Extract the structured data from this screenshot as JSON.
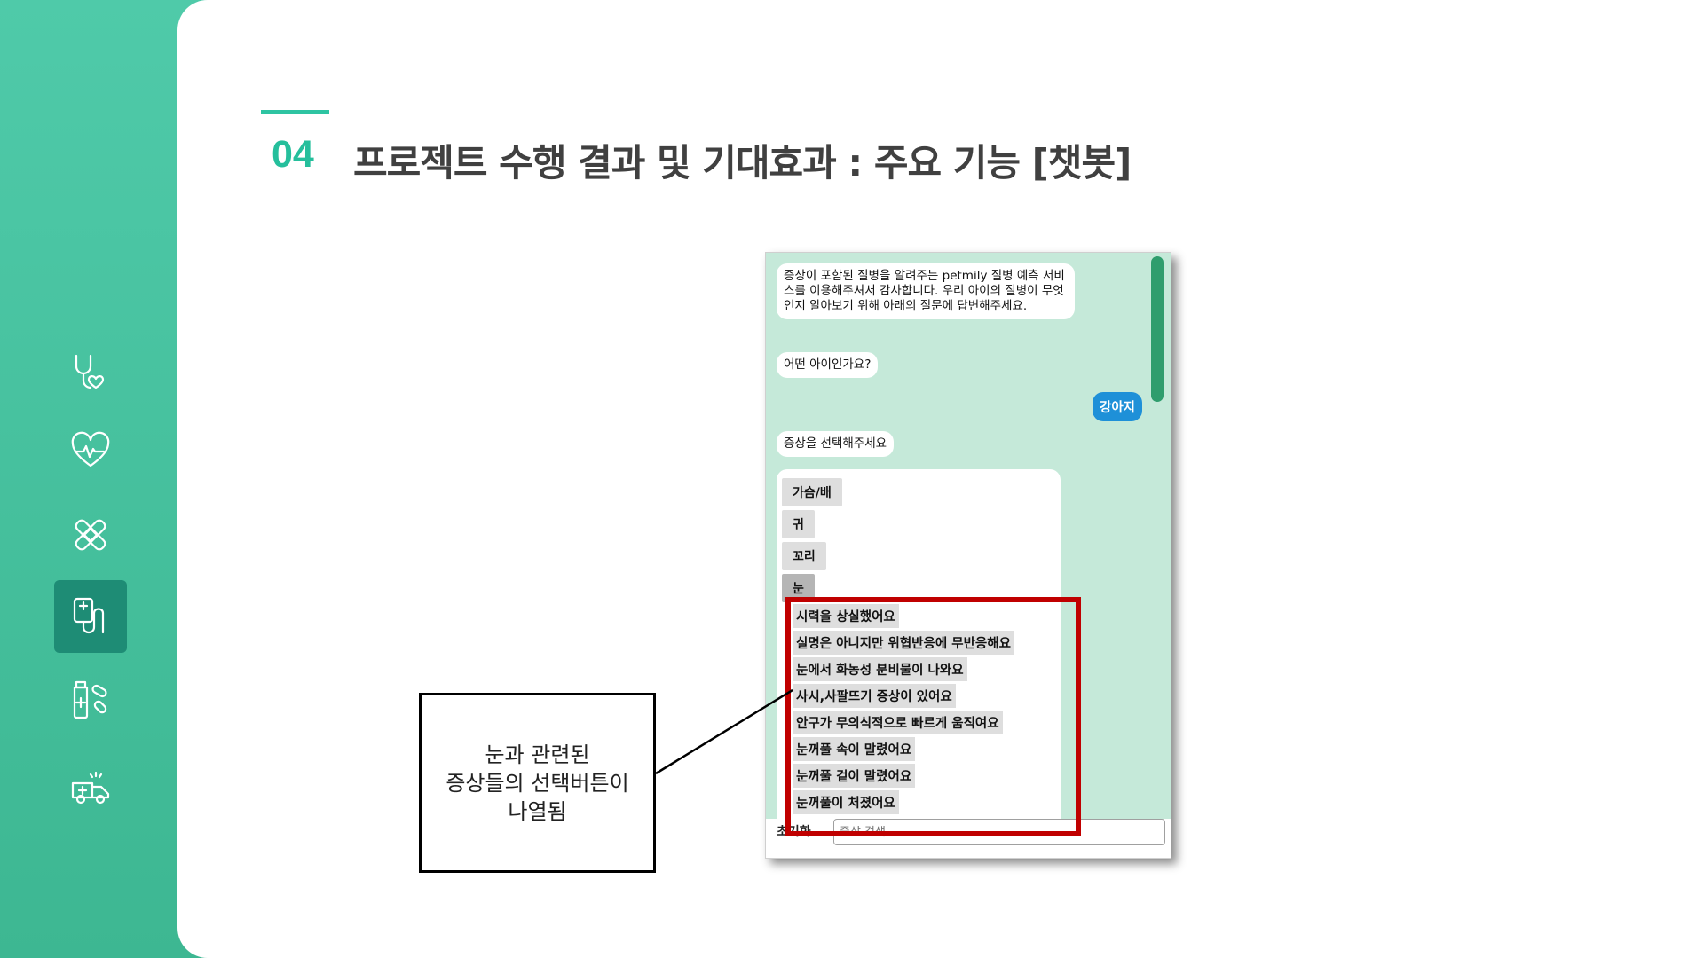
{
  "header": {
    "number": "04",
    "title": "프로젝트 수행 결과 및 기대효과 : 주요 기능 [챗봇]"
  },
  "sidebar": {
    "icons": [
      "stethoscope-heart-icon",
      "heartbeat-icon",
      "bandage-icon",
      "iv-drip-icon",
      "medicine-pills-icon",
      "ambulance-icon"
    ],
    "active_index": 3
  },
  "chat": {
    "greeting": "증상이 포함된 질병을 알려주는 petmily 질병 예측 서비스를 이용해주셔서 감사합니다. 우리 아이의 질병이 무엇인지 알아보기 위해 아래의 질문에 답변해주세요.",
    "q_animal": "어떤 아이인가요?",
    "user_answer": "강아지",
    "q_symptom": "증상을 선택해주세요",
    "body_parts": [
      "가슴/배",
      "귀",
      "꼬리",
      "눈"
    ],
    "selected_part": "눈",
    "eye_symptoms": [
      "시력을 상실했어요",
      "실명은 아니지만 위협반응에 무반응해요",
      "눈에서 화농성 분비물이 나와요",
      "사시,사팔뜨기 증상이 있어요",
      "안구가 무의식적으로 빠르게 움직여요",
      "눈꺼풀 속이 말렸어요",
      "눈꺼풀 겉이 말렸어요",
      "눈꺼풀이 처졌어요"
    ],
    "reset_label": "초기화",
    "search_placeholder": "증상 검색"
  },
  "annotation": {
    "line1": "눈과 관련된",
    "line2": "증상들의 선택버튼이",
    "line3": "나열됨"
  },
  "colors": {
    "sidebar": "#45c3a0",
    "accent": "#25bf9c",
    "chat_bg": "#c5e9d9",
    "user_bubble": "#1e90d8",
    "highlight": "#c00000"
  }
}
